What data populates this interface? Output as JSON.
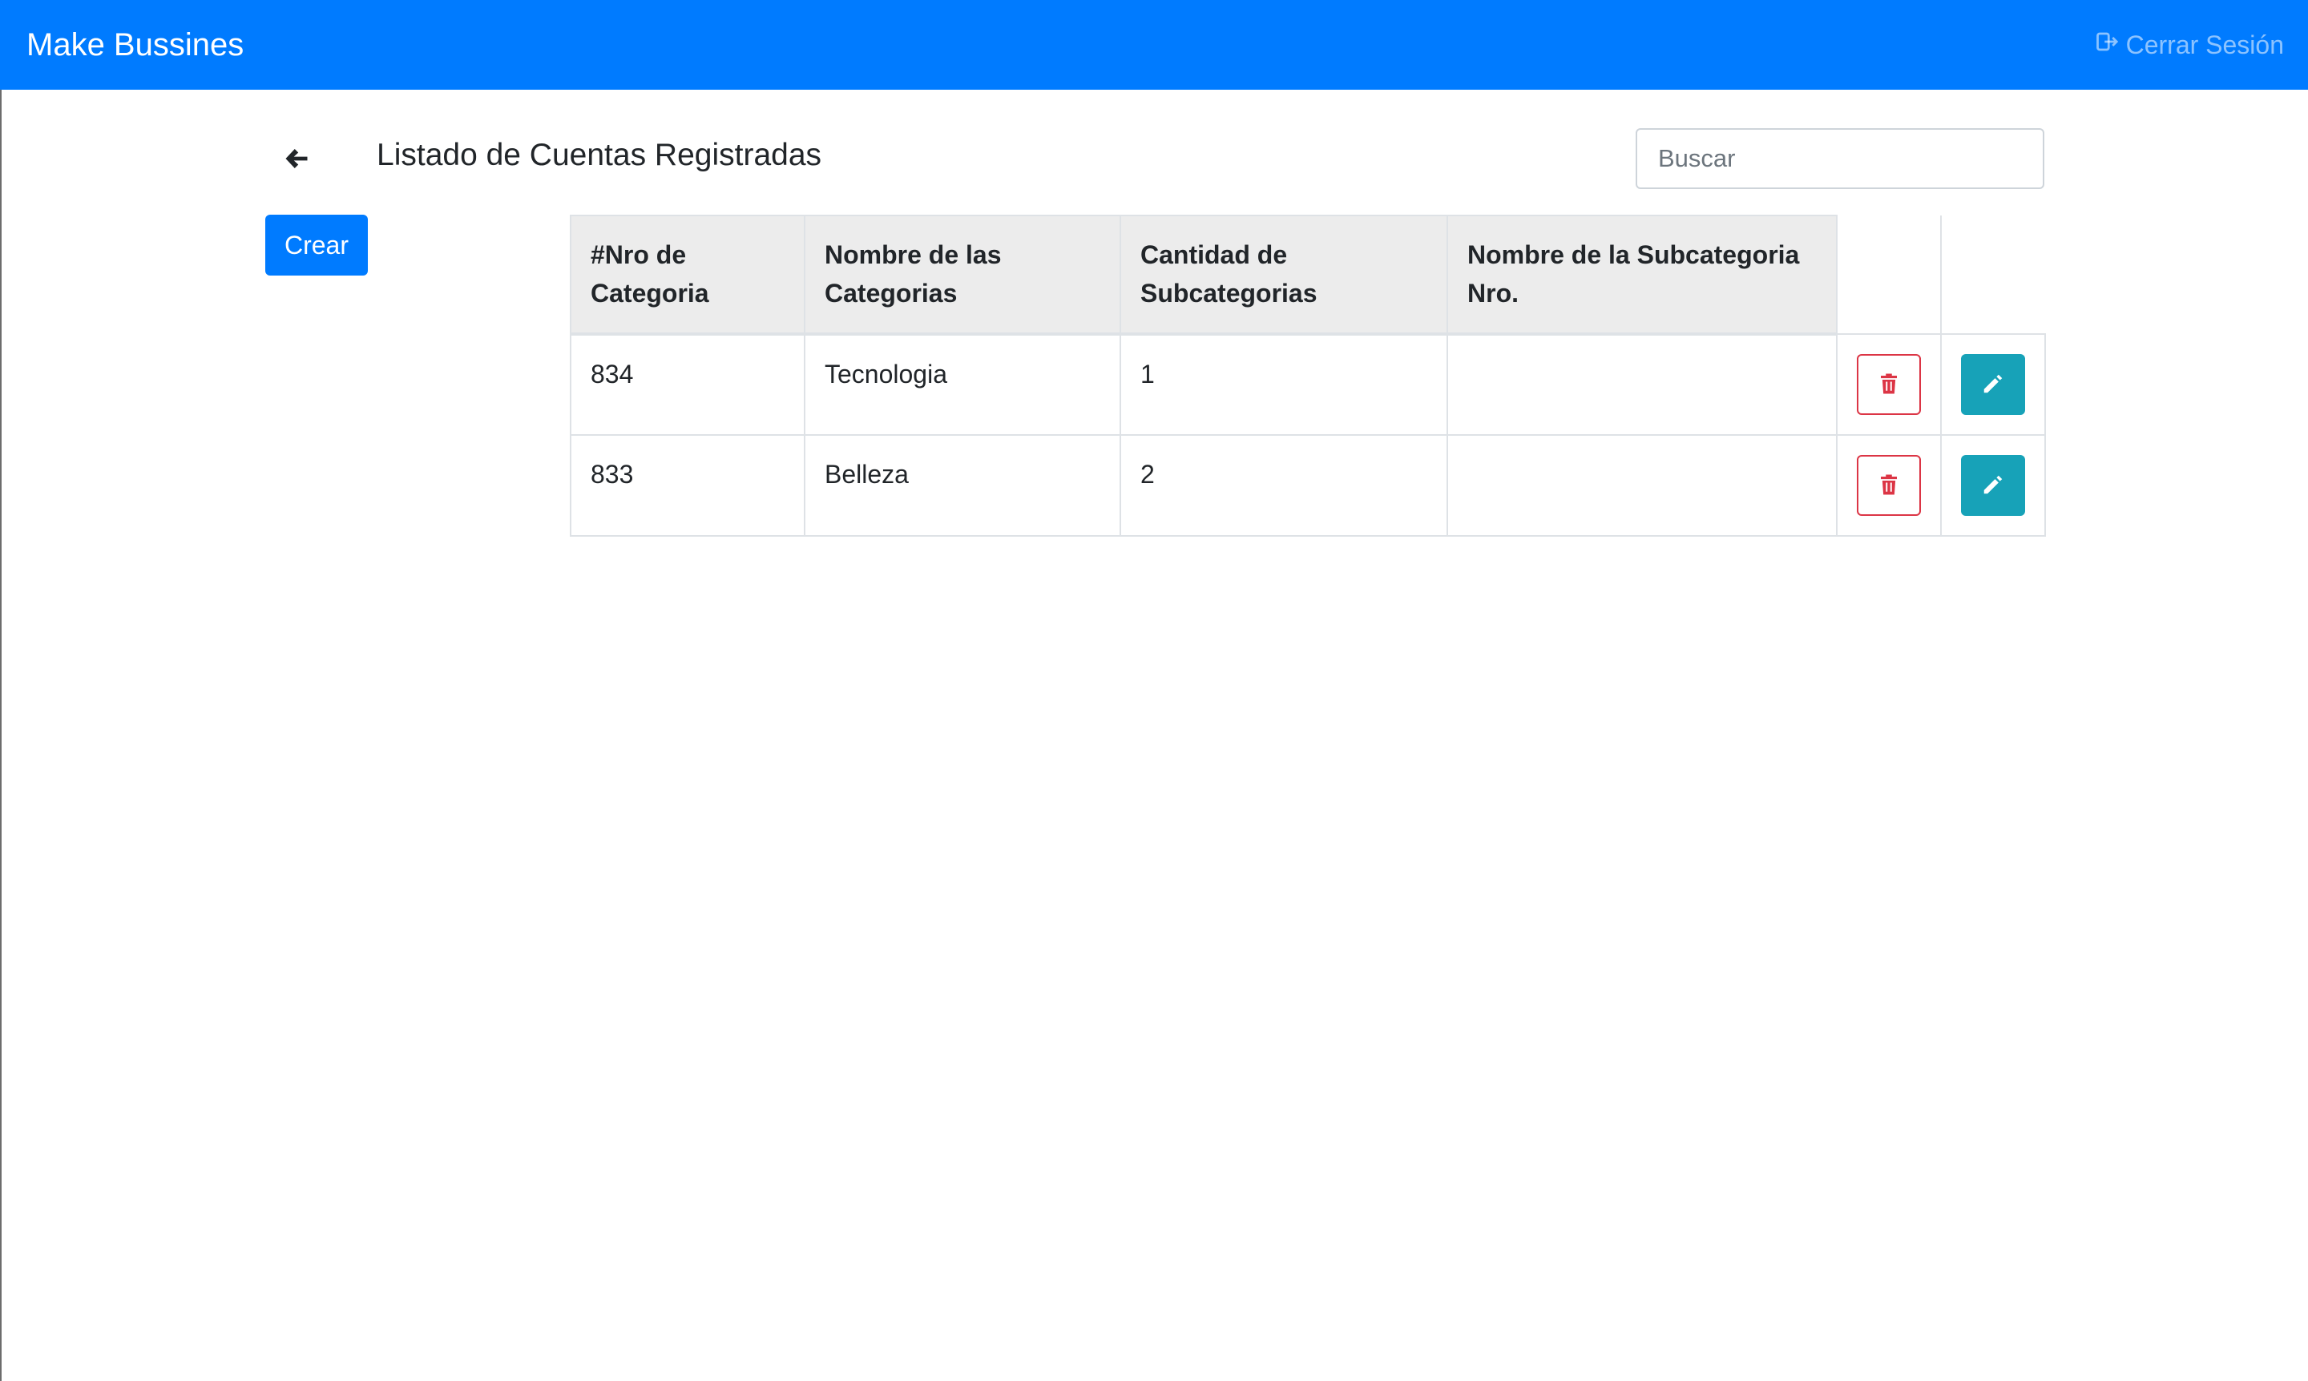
{
  "navbar": {
    "brand": "Make Bussines",
    "logout_label": "Cerrar Sesión"
  },
  "page": {
    "title": "Listado de Cuentas Registradas",
    "create_label": "Crear"
  },
  "search": {
    "placeholder": "Buscar",
    "value": ""
  },
  "table": {
    "headers": [
      "#Nro de Categoria",
      "Nombre de las Categorias",
      "Cantidad de Subcategorias",
      "Nombre de la Subcategoria Nro."
    ],
    "rows": [
      {
        "nro": "834",
        "nombre": "Tecnologia",
        "cantidad": "1",
        "subcategoria": ""
      },
      {
        "nro": "833",
        "nombre": "Belleza",
        "cantidad": "2",
        "subcategoria": ""
      }
    ]
  },
  "colors": {
    "primary": "#007bff",
    "danger": "#dc3545",
    "info": "#17a2b8",
    "header_bg": "#ececec"
  },
  "icons": {
    "back": "arrow-left-icon",
    "logout": "sign-out-icon",
    "delete": "trash-icon",
    "edit": "pencil-icon"
  }
}
